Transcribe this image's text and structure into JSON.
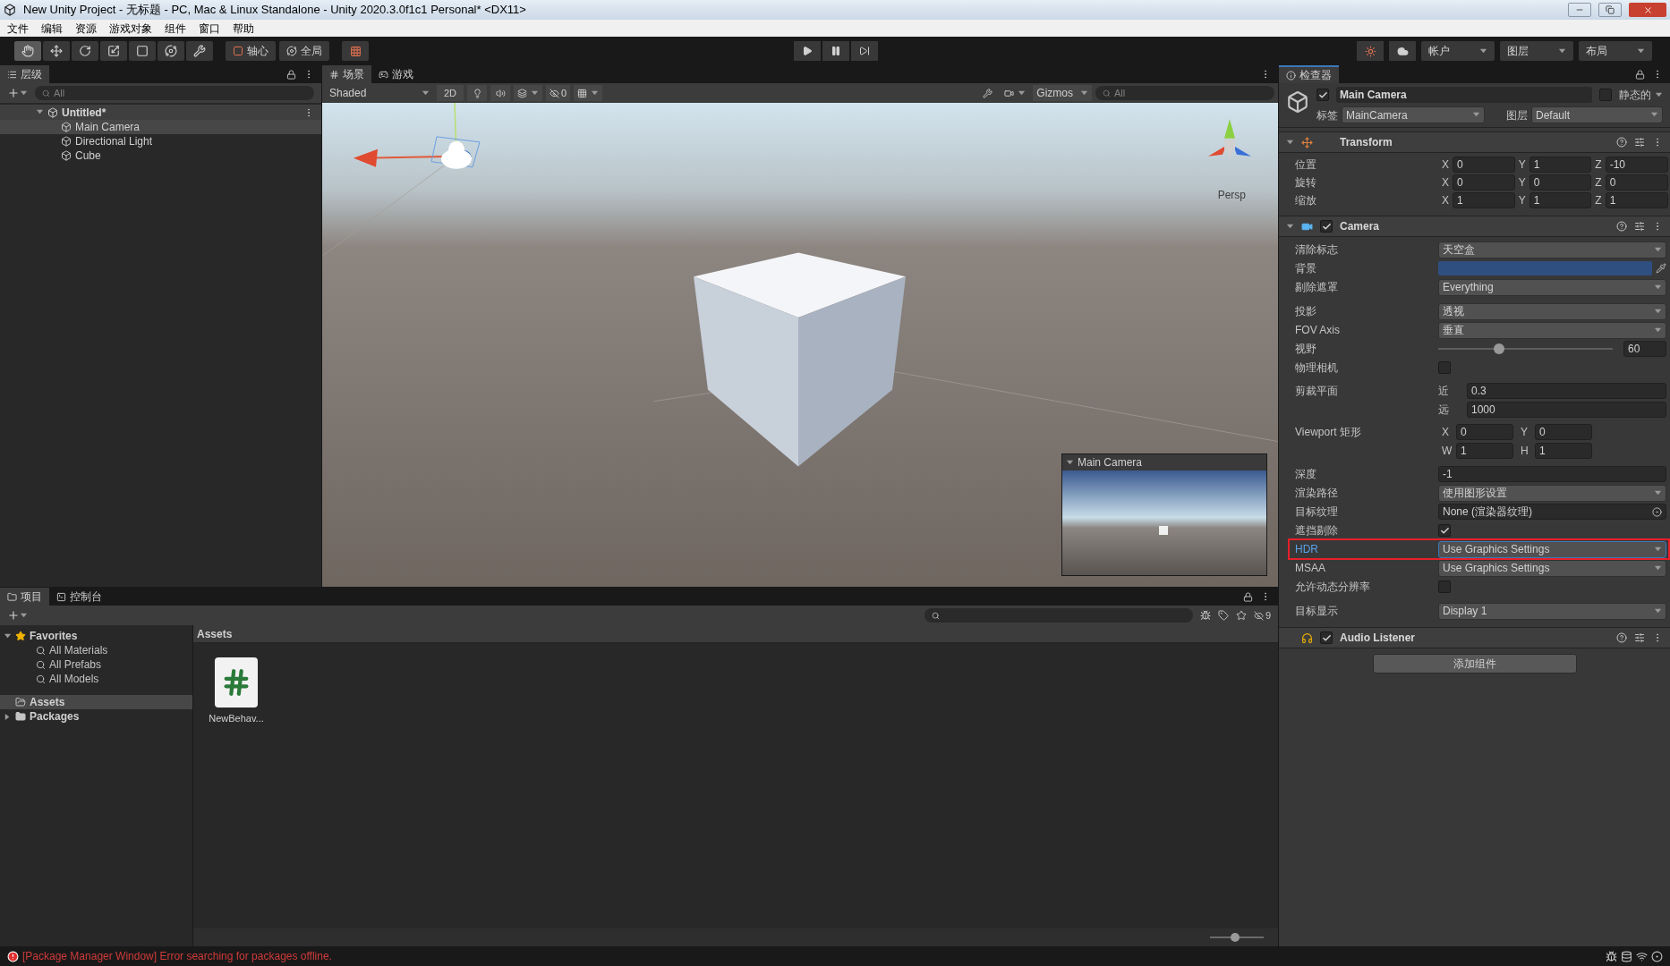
{
  "window": {
    "title": "New Unity Project - 无标题 - PC, Mac & Linux Standalone - Unity 2020.3.0f1c1 Personal* <DX11>"
  },
  "menu": [
    "文件",
    "编辑",
    "资源",
    "游戏对象",
    "组件",
    "窗口",
    "帮助"
  ],
  "toolbar": {
    "tools": [
      {
        "kind": "hand",
        "selected": true
      },
      {
        "kind": "move",
        "selected": false
      },
      {
        "kind": "rotate",
        "selected": false
      },
      {
        "kind": "scale",
        "selected": false
      },
      {
        "kind": "rect",
        "selected": false
      },
      {
        "kind": "transform",
        "selected": false
      },
      {
        "kind": "custom",
        "selected": false
      }
    ],
    "pivot": "轴心",
    "space": "全局",
    "account": "帐户",
    "layers": "图层",
    "layout": "布局"
  },
  "hierarchy": {
    "tab": "层级",
    "search_placeholder": "All",
    "scene": {
      "name": "Untitled*",
      "expanded": true,
      "children": [
        {
          "name": "Main Camera",
          "selected": true
        },
        {
          "name": "Directional Light",
          "selected": false
        },
        {
          "name": "Cube",
          "selected": false
        }
      ]
    }
  },
  "scene_view": {
    "tabs": [
      {
        "label": "场景",
        "kind": "scene",
        "selected": true
      },
      {
        "label": "游戏",
        "kind": "game",
        "selected": false
      }
    ],
    "shading": "Shaded",
    "mode_2d": "2D",
    "hidden_count": "0",
    "gizmos": "Gizmos",
    "search_placeholder": "All",
    "projection": "Persp",
    "camera_preview": {
      "title": "Main Camera"
    }
  },
  "inspector": {
    "tab": "检查器",
    "object": {
      "name": "Main Camera",
      "active": true,
      "static_label": "静态的",
      "static": false,
      "tag_label": "标签",
      "tag": "MainCamera",
      "layer_label": "图层",
      "layer": "Default"
    },
    "components": [
      {
        "kind": "transform",
        "title": "Transform",
        "rows": [
          {
            "label": "位置",
            "fields": [
              {
                "axis": "X",
                "value": "0"
              },
              {
                "axis": "Y",
                "value": "1"
              },
              {
                "axis": "Z",
                "value": "-10"
              }
            ]
          },
          {
            "label": "旋转",
            "fields": [
              {
                "axis": "X",
                "value": "0"
              },
              {
                "axis": "Y",
                "value": "0"
              },
              {
                "axis": "Z",
                "value": "0"
              }
            ]
          },
          {
            "label": "缩放",
            "fields": [
              {
                "axis": "X",
                "value": "1"
              },
              {
                "axis": "Y",
                "value": "1"
              },
              {
                "axis": "Z",
                "value": "1"
              }
            ]
          }
        ]
      },
      {
        "kind": "camera",
        "title": "Camera",
        "enabled": true,
        "props": [
          {
            "kind": "dropdown",
            "label": "清除标志",
            "value": "天空盒"
          },
          {
            "kind": "color",
            "label": "背景",
            "color": "#2f4f80"
          },
          {
            "kind": "dropdown",
            "label": "剔除遮罩",
            "value": "Everything"
          },
          {
            "kind": "dropdown",
            "label": "投影",
            "value": "透视"
          },
          {
            "kind": "dropdown",
            "label": "FOV Axis",
            "value": "垂直"
          },
          {
            "kind": "slider",
            "label": "视野",
            "level": 0.34,
            "value": "60"
          },
          {
            "kind": "checkbox",
            "label": "物理相机",
            "checked": false
          },
          {
            "kind": "pair",
            "label": "剪裁平面",
            "fields": [
              {
                "label": "近",
                "value": "0.3"
              },
              {
                "label": "远",
                "value": "1000"
              }
            ]
          },
          {
            "kind": "grid",
            "label": "Viewport 矩形",
            "fields": [
              {
                "label": "X",
                "value": "0"
              },
              {
                "label": "Y",
                "value": "0"
              },
              {
                "label": "W",
                "value": "1"
              },
              {
                "label": "H",
                "value": "1"
              }
            ]
          },
          {
            "kind": "number",
            "label": "深度",
            "value": "-1"
          },
          {
            "kind": "dropdown",
            "label": "渲染路径",
            "value": "使用图形设置"
          },
          {
            "kind": "object",
            "label": "目标纹理",
            "value": "None (渲染器纹理)"
          },
          {
            "kind": "checkbox",
            "label": "遮挡剔除",
            "checked": true
          },
          {
            "kind": "dropdown",
            "label": "HDR",
            "value": "Use Graphics Settings",
            "focused": true,
            "highlighted": true
          },
          {
            "kind": "dropdown",
            "label": "MSAA",
            "value": "Use Graphics Settings",
            "focused": false,
            "highlighted": false
          },
          {
            "kind": "checkbox",
            "label": "允许动态分辨率",
            "checked": false
          },
          {
            "kind": "dropdown",
            "label": "目标显示",
            "value": "Display 1"
          }
        ]
      },
      {
        "kind": "audio",
        "title": "Audio Listener",
        "enabled": true
      }
    ],
    "add_component": "添加组件"
  },
  "project": {
    "tabs": [
      {
        "label": "项目",
        "kind": "project",
        "selected": true
      },
      {
        "label": "控制台",
        "kind": "console",
        "selected": false
      }
    ],
    "hidden_count": "9",
    "tree": [
      {
        "name": "Favorites",
        "kind": "favorites",
        "expanded": true,
        "selected": false,
        "children": [
          {
            "name": "All Materials"
          },
          {
            "name": "All Prefabs"
          },
          {
            "name": "All Models"
          }
        ]
      },
      {
        "name": "Assets",
        "kind": "folder",
        "selected": true
      },
      {
        "name": "Packages",
        "kind": "folder",
        "expanded": false,
        "selected": false
      }
    ],
    "breadcrumb": "Assets",
    "assets": [
      {
        "name": "NewBehav..."
      }
    ],
    "zoom_slider": {
      "level": 0.45
    }
  },
  "status_bar": {
    "messages": [
      {
        "kind": "error",
        "text": "[Package Manager Window] Error searching for packages offline."
      }
    ]
  }
}
